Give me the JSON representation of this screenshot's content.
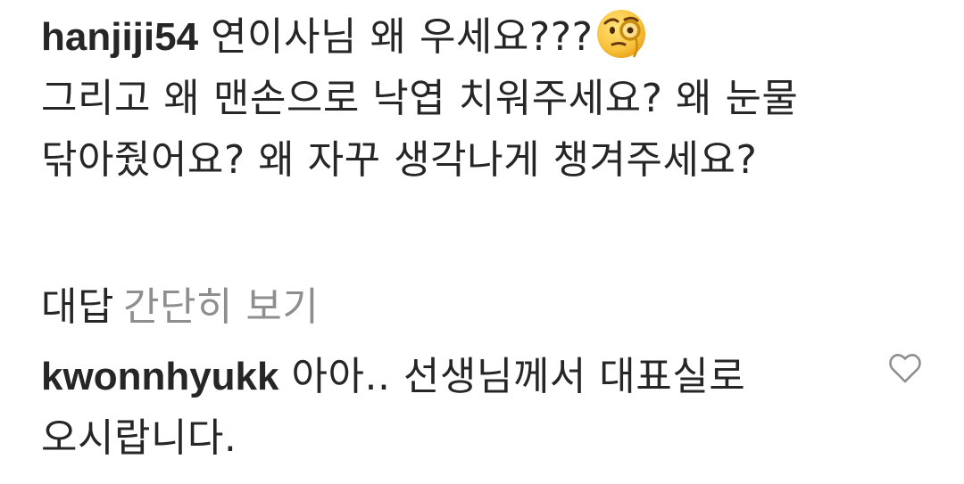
{
  "comments": [
    {
      "username": "hanjiji54",
      "text_part1": "연이사님 왜 우세요???",
      "emoji": "face-with-monocle",
      "text_part2": "그리고 왜 맨손으로 낙엽 치워주세요? 왜 눈물 닦아줬어요? 왜 자꾸 생각나게 챙겨주세요?"
    },
    {
      "username": "kwonnhyukk",
      "text": "아아.. 선생님께서 대표실로 오시랍니다."
    }
  ],
  "replies": {
    "label": "대답",
    "toggle": "간단히 보기"
  },
  "colors": {
    "text": "#262626",
    "muted": "#8e8e8e",
    "icon": "#8e8e8e",
    "background": "#ffffff"
  },
  "icons": {
    "like": "heart-outline-icon",
    "emoji": "face-with-monocle-icon"
  }
}
